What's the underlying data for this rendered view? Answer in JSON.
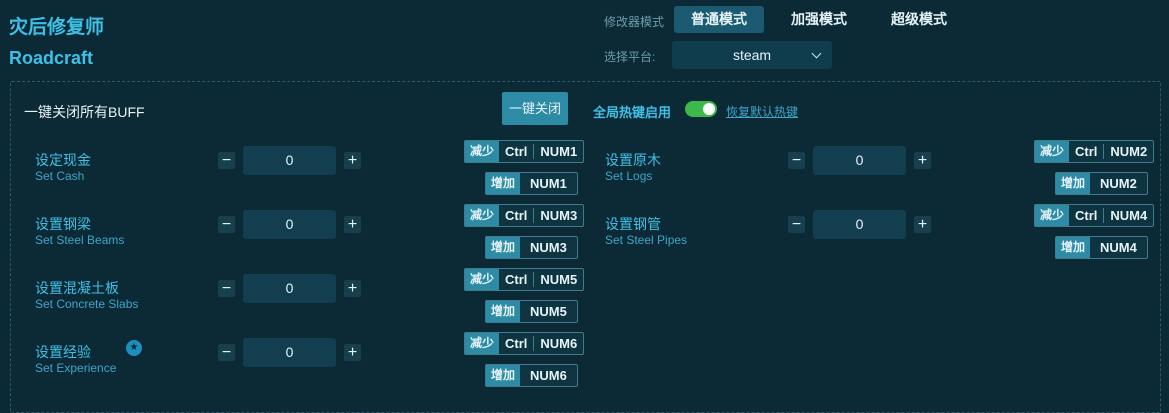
{
  "app": {
    "title_cn": "灾后修复师",
    "title_en": "Roadcraft"
  },
  "mode": {
    "label": "修改器模式",
    "options": [
      "普通模式",
      "加强模式",
      "超级模式"
    ],
    "selected": "普通模式"
  },
  "platform": {
    "label": "选择平台:",
    "value": "steam"
  },
  "buff": {
    "label": "一键关闭所有BUFF",
    "button": "一键关闭"
  },
  "hotkeys": {
    "label": "全局热键启用",
    "enabled": true,
    "restore": "恢复默认热键"
  },
  "hotkey_tags": {
    "decrease": "减少",
    "increase": "增加"
  },
  "items": [
    {
      "cn": "设定现金",
      "en": "Set Cash",
      "value": "0",
      "dec_mod": "Ctrl",
      "dec_key": "NUM1",
      "inc_key": "NUM1",
      "starred": false
    },
    {
      "cn": "设置钢梁",
      "en": "Set Steel Beams",
      "value": "0",
      "dec_mod": "Ctrl",
      "dec_key": "NUM3",
      "inc_key": "NUM3",
      "starred": false
    },
    {
      "cn": "设置混凝土板",
      "en": "Set Concrete Slabs",
      "value": "0",
      "dec_mod": "Ctrl",
      "dec_key": "NUM5",
      "inc_key": "NUM5",
      "starred": false
    },
    {
      "cn": "设置经验",
      "en": "Set Experience",
      "value": "0",
      "dec_mod": "Ctrl",
      "dec_key": "NUM6",
      "inc_key": "NUM6",
      "starred": true
    },
    {
      "cn": "设置原木",
      "en": "Set Logs",
      "value": "0",
      "dec_mod": "Ctrl",
      "dec_key": "NUM2",
      "inc_key": "NUM2",
      "starred": false
    },
    {
      "cn": "设置钢管",
      "en": "Set Steel Pipes",
      "value": "0",
      "dec_mod": "Ctrl",
      "dec_key": "NUM4",
      "inc_key": "NUM4",
      "starred": false
    }
  ],
  "colors": {
    "accent": "#3fc0e6",
    "background": "#0b2a36",
    "toggle_on": "#3db84b",
    "tag": "#2d8ba6"
  }
}
